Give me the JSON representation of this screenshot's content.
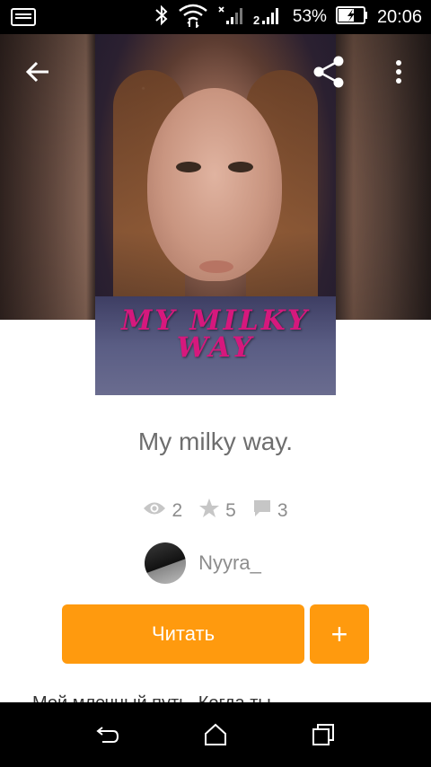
{
  "status_bar": {
    "battery_percent": "53%",
    "time": "20:06",
    "icons": [
      "screenshot-icon",
      "bluetooth-icon",
      "wifi-icon",
      "signal-icon",
      "signal-2g-icon",
      "battery-charging-icon"
    ]
  },
  "toolbar": {
    "back_icon": "arrow-left-icon",
    "share_icon": "share-icon",
    "more_icon": "more-vertical-icon"
  },
  "book": {
    "cover_title": "MY MILKY WAY",
    "title": "My milky way.",
    "stats": {
      "views": "2",
      "votes": "5",
      "comments": "3"
    },
    "author": "Nyyra_",
    "description_partial": "Мой млечный путь. Когда ты..."
  },
  "actions": {
    "read_label": "Читать",
    "add_label": "+"
  },
  "nav_bar": {
    "icons": [
      "back-nav-icon",
      "home-nav-icon",
      "recents-nav-icon"
    ]
  },
  "colors": {
    "accent": "#ff9a0e",
    "text_muted": "#8d8d8d",
    "title_text": "#6e6e6e",
    "cover_title": "#d6187d"
  }
}
